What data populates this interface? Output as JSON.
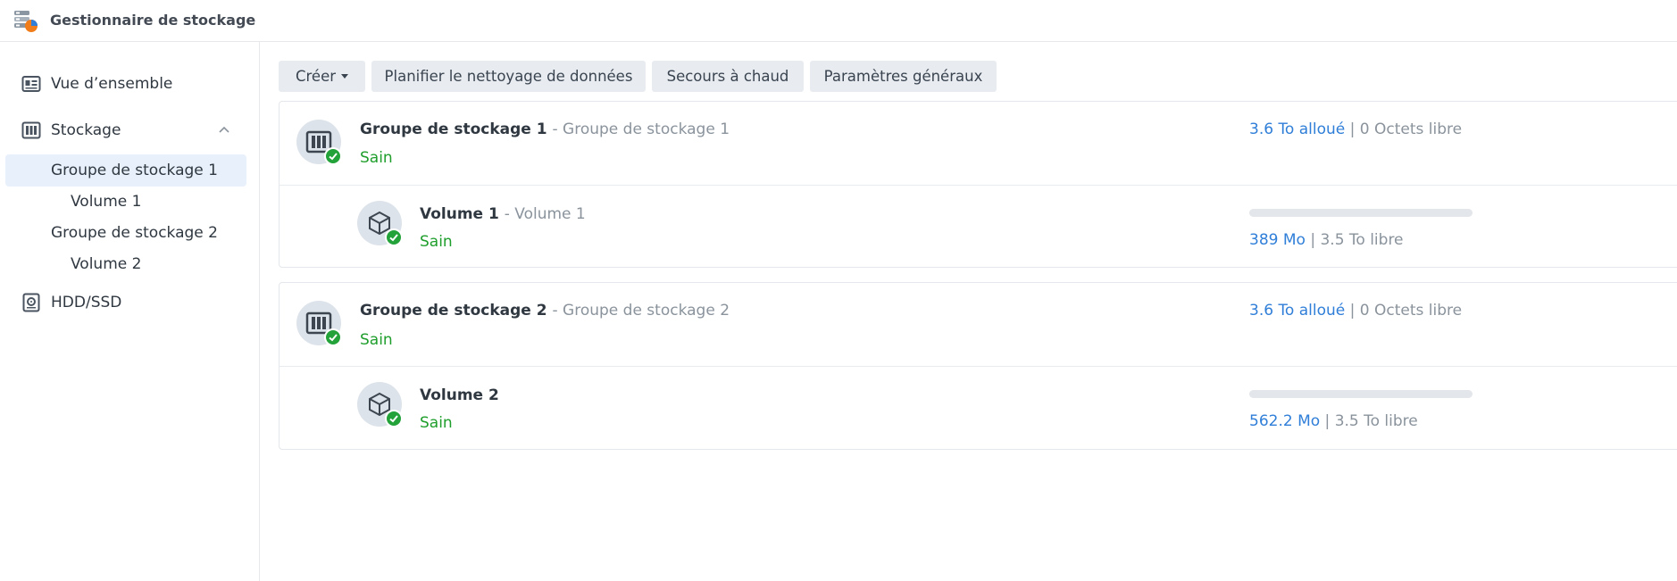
{
  "app": {
    "title": "Gestionnaire de stockage",
    "icon": "storage-manager-icon"
  },
  "sidebar": {
    "overview": {
      "label": "Vue d’ensemble",
      "icon": "overview-icon"
    },
    "storage": {
      "label": "Stockage",
      "icon": "storage-icon",
      "expanded": true
    },
    "sub_items": [
      {
        "label": "Groupe de stockage 1",
        "active": true
      },
      {
        "label": "Volume 1",
        "active": false
      },
      {
        "label": "Groupe de stockage 2",
        "active": false
      },
      {
        "label": "Volume 2",
        "active": false
      }
    ],
    "hdd": {
      "label": "HDD/SSD",
      "icon": "hdd-icon"
    }
  },
  "toolbar": {
    "create_label": "Créer",
    "schedule_label": "Planifier le nettoyage de données",
    "hotspare_label": "Secours à chaud",
    "settings_label": "Paramètres généraux"
  },
  "pools": [
    {
      "name": "Groupe de stockage 1",
      "desc": "- Groupe de stockage 1",
      "status": "Sain",
      "allocated": "3.6 To alloué",
      "sep": "|",
      "free": "0 Octets libre",
      "volume": {
        "name": "Volume 1",
        "desc": "- Volume 1",
        "status": "Sain",
        "used": "389 Mo",
        "sep": "|",
        "free": "3.5 To libre",
        "used_fraction": 0.0001
      }
    },
    {
      "name": "Groupe de stockage 2",
      "desc": "- Groupe de stockage 2",
      "status": "Sain",
      "allocated": "3.6 To alloué",
      "sep": "|",
      "free": "0 Octets libre",
      "volume": {
        "name": "Volume 2",
        "desc": "",
        "status": "Sain",
        "used": "562.2 Mo",
        "sep": "|",
        "free": "3.5 To libre",
        "used_fraction": 0.00015
      }
    }
  ],
  "colors": {
    "accent": "#2f7ed8",
    "healthy": "#1f9e2c",
    "check": "#23a23a",
    "active_bg": "#e8f0fb"
  }
}
